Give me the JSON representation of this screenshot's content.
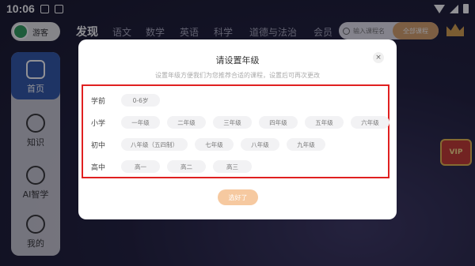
{
  "status_bar": {
    "time": "10:06"
  },
  "header": {
    "username": "游客",
    "tabs": [
      {
        "label": "发现",
        "active": true
      },
      {
        "label": "语文"
      },
      {
        "label": "数学"
      },
      {
        "label": "英语"
      },
      {
        "label": "科学"
      },
      {
        "label": "道德与法治"
      },
      {
        "label": "会员"
      }
    ],
    "search_placeholder": "输入课程名",
    "all_courses_label": "全部课程"
  },
  "sidebar": {
    "items": [
      {
        "label": "首页",
        "icon": "home-icon",
        "active": true
      },
      {
        "label": "知识",
        "icon": "bulb-icon"
      },
      {
        "label": "AI智学",
        "icon": "book-icon"
      },
      {
        "label": "我的",
        "icon": "face-icon"
      }
    ]
  },
  "vip_badge": "VIP",
  "modal": {
    "title": "请设置年级",
    "subtitle": "设置年级方便我们为您推荐合适的课程，设置后可再次更改",
    "close_label": "×",
    "rows": [
      {
        "label": "学前",
        "options": [
          "0-6岁"
        ]
      },
      {
        "label": "小学",
        "options": [
          "一年级",
          "二年级",
          "三年级",
          "四年级",
          "五年级",
          "六年级"
        ]
      },
      {
        "label": "初中",
        "options": [
          "八年级（五四制）",
          "七年级",
          "八年级",
          "九年级"
        ]
      },
      {
        "label": "高中",
        "options": [
          "高一",
          "高二",
          "高三"
        ]
      }
    ],
    "confirm_label": "选好了"
  },
  "colors": {
    "accent": "#2f56a8",
    "highlight_border": "#e02020",
    "confirm": "#f6c9a0"
  }
}
